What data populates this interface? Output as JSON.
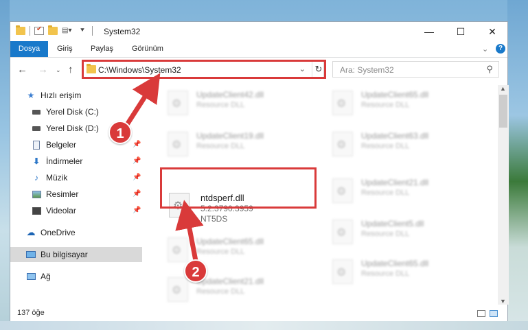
{
  "window": {
    "title": "System32",
    "controls": [
      "minimize-icon",
      "maximize-icon",
      "close-icon"
    ]
  },
  "ribbon": {
    "tabs": [
      "Dosya",
      "Giriş",
      "Paylaş",
      "Görünüm"
    ],
    "active_tab": "Dosya"
  },
  "address": {
    "path": "C:\\Windows\\System32",
    "search_placeholder": "Ara: System32"
  },
  "sidebar": {
    "items": [
      {
        "label": "Hızlı erişim",
        "icon": "star-icon",
        "pinned": false
      },
      {
        "label": "Yerel Disk (C:)",
        "icon": "drive-icon",
        "pinned": false
      },
      {
        "label": "Yerel Disk (D:)",
        "icon": "drive-icon",
        "pinned": false
      },
      {
        "label": "Belgeler",
        "icon": "documents-icon",
        "pinned": true
      },
      {
        "label": "İndirmeler",
        "icon": "download-icon",
        "pinned": true
      },
      {
        "label": "Müzik",
        "icon": "music-icon",
        "pinned": true
      },
      {
        "label": "Resimler",
        "icon": "pictures-icon",
        "pinned": true
      },
      {
        "label": "Videolar",
        "icon": "videos-icon",
        "pinned": true
      },
      {
        "label": "OneDrive",
        "icon": "cloud-icon",
        "pinned": false
      },
      {
        "label": "Bu bilgisayar",
        "icon": "computer-icon",
        "pinned": false,
        "selected": true
      },
      {
        "label": "Ağ",
        "icon": "network-icon",
        "pinned": false
      }
    ]
  },
  "files": {
    "col1": [
      {
        "name": "UpdateClient42.dll",
        "type": "Resource DLL"
      },
      {
        "name": "UpdateClient19.dll",
        "type": "Resource DLL"
      },
      {
        "name": "UpdateClient65.dll",
        "type": "Resource DLL"
      },
      {
        "name": "UpdateClient21.dll",
        "type": "Resource DLL"
      }
    ],
    "col2": [
      {
        "name": "UpdateClient65.dll",
        "type": "Resource DLL"
      },
      {
        "name": "UpdateClient63.dll",
        "type": "Resource DLL"
      },
      {
        "name": "UpdateClient21.dll",
        "type": "Resource DLL"
      },
      {
        "name": "UpdateClient5.dll",
        "type": "Resource DLL"
      },
      {
        "name": "UpdateClient65.dll",
        "type": "Resource DLL"
      }
    ],
    "highlighted": {
      "name": "ntdsperf.dll",
      "version": "5.2.3790.3959",
      "description": "NT5DS"
    }
  },
  "status": {
    "count": "137 öğe"
  },
  "annotations": {
    "badge1": "1",
    "badge2": "2",
    "color": "#d93a3a"
  },
  "colors": {
    "accent": "#1979ca",
    "folder": "#f2c44d",
    "highlight_box": "#d93a3a"
  }
}
